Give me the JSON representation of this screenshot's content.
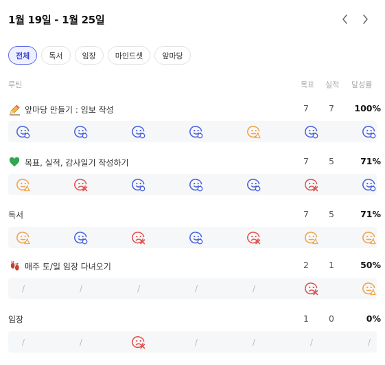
{
  "header": {
    "range": "1월 19일 - 1월 25일"
  },
  "nav": {
    "prev_icon": "chevron-left-icon",
    "next_icon": "chevron-right-icon"
  },
  "filters": [
    {
      "label": "전체",
      "active": true
    },
    {
      "label": "독서",
      "active": false
    },
    {
      "label": "임장",
      "active": false
    },
    {
      "label": "마인드셋",
      "active": false
    },
    {
      "label": "앞마당",
      "active": false
    }
  ],
  "columns": {
    "routine": "루틴",
    "target": "목표",
    "actual": "실적",
    "rate": "달성률"
  },
  "colors": {
    "done": "#4a63e0",
    "partial": "#f0a34a",
    "failed": "#e0534f",
    "none": "#bbbbbb"
  },
  "routines": [
    {
      "name": "앞마당 만들기 : 임보 작성",
      "emoji": "pencil-icon",
      "target": "7",
      "actual": "7",
      "rate": "100%",
      "days": [
        "done",
        "done",
        "done",
        "done",
        "partial",
        "done",
        "done"
      ]
    },
    {
      "name": "목표, 실적, 감사일기 작성하기",
      "emoji": "green-heart-icon",
      "target": "7",
      "actual": "5",
      "rate": "71%",
      "days": [
        "partial",
        "failed",
        "done",
        "done",
        "done",
        "failed",
        "done"
      ]
    },
    {
      "name": "독서",
      "emoji": "",
      "target": "7",
      "actual": "5",
      "rate": "71%",
      "days": [
        "partial",
        "done",
        "failed",
        "done",
        "failed",
        "partial",
        "partial"
      ]
    },
    {
      "name": "매주 토/일 임장 다녀오기",
      "emoji": "footprints-icon",
      "target": "2",
      "actual": "1",
      "rate": "50%",
      "days": [
        "none",
        "none",
        "none",
        "none",
        "none",
        "failed",
        "partial"
      ]
    },
    {
      "name": "임장",
      "emoji": "",
      "target": "1",
      "actual": "0",
      "rate": "0%",
      "days": [
        "none",
        "none",
        "failed",
        "none",
        "none",
        "none",
        "none"
      ]
    }
  ]
}
